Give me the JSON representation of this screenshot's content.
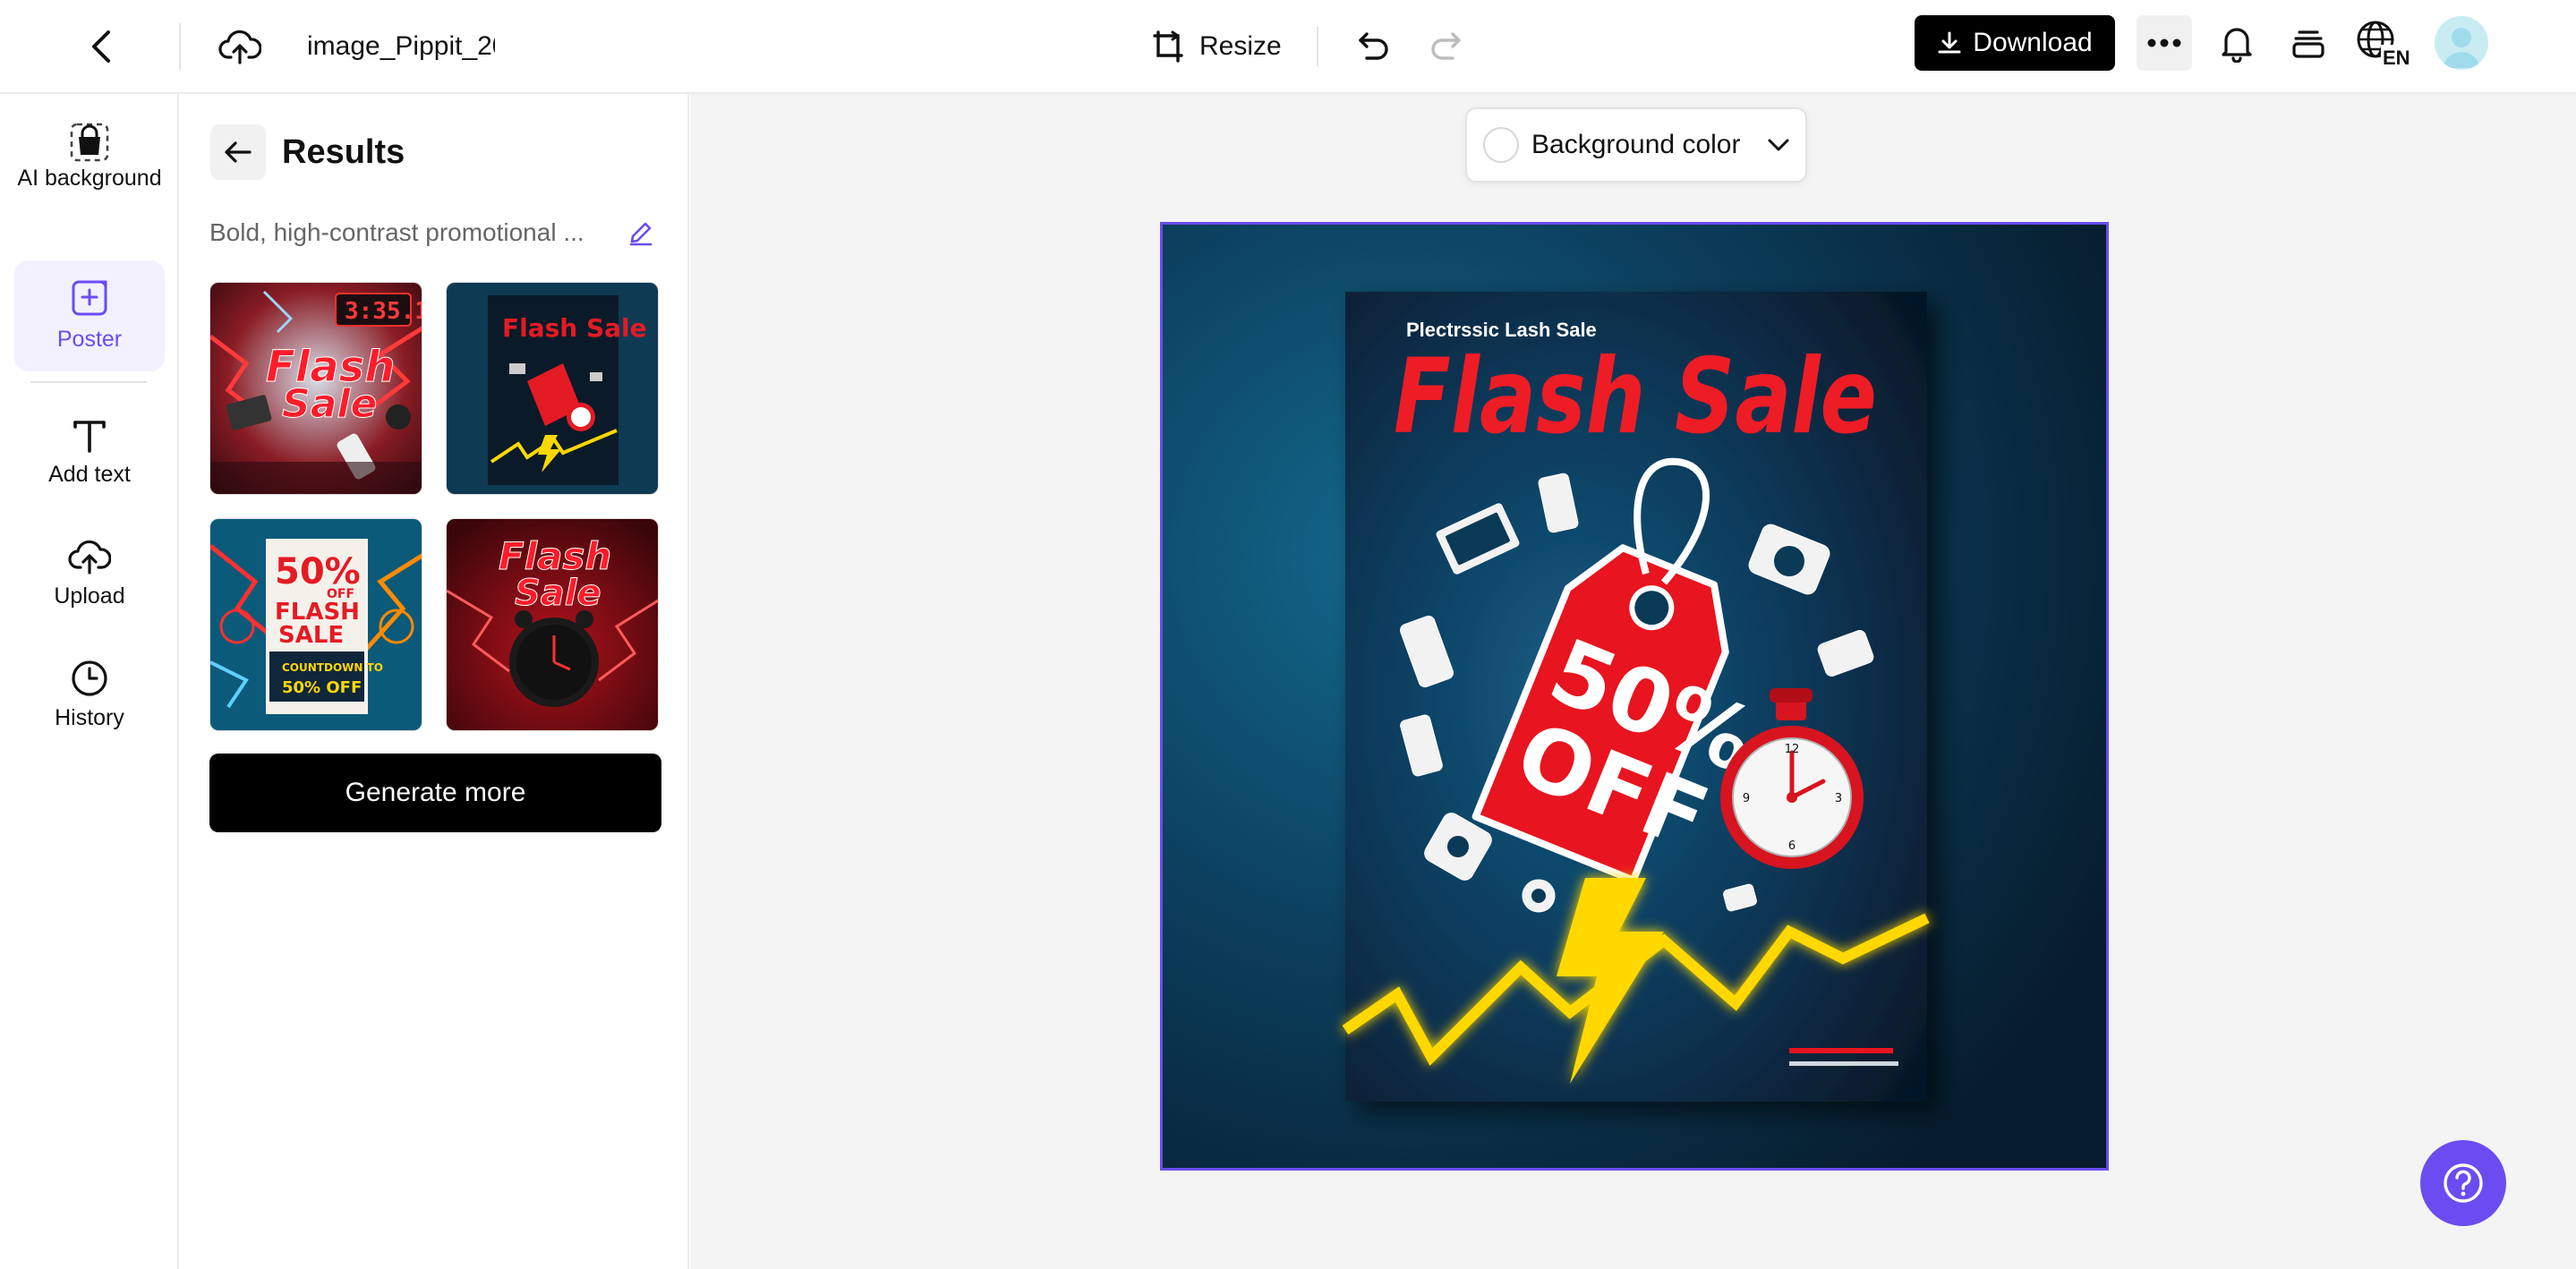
{
  "header": {
    "filename": "image_Pippit_20",
    "resize_label": "Resize",
    "download_label": "Download",
    "language": "EN"
  },
  "rail": {
    "items": [
      {
        "label": "AI background",
        "icon": "ai-background-icon"
      },
      {
        "label": "Poster",
        "icon": "poster-icon",
        "active": true
      },
      {
        "label": "Add text",
        "icon": "text-icon"
      },
      {
        "label": "Upload",
        "icon": "upload-icon"
      },
      {
        "label": "History",
        "icon": "history-icon"
      }
    ]
  },
  "panel": {
    "title": "Results",
    "prompt": "Bold, high-contrast promotional ...",
    "generate_label": "Generate more"
  },
  "canvas": {
    "background_color_label": "Background color",
    "poster": {
      "subtitle": "Plectrssic Lash Sale",
      "headline": "Flash Sale",
      "badge_line1": "50%",
      "badge_line2": "OFF"
    }
  },
  "colors": {
    "accent": "#6b4cf0",
    "poster_red": "#e8141f",
    "poster_yellow": "#ffd800",
    "poster_navy": "#0b2d4a"
  }
}
